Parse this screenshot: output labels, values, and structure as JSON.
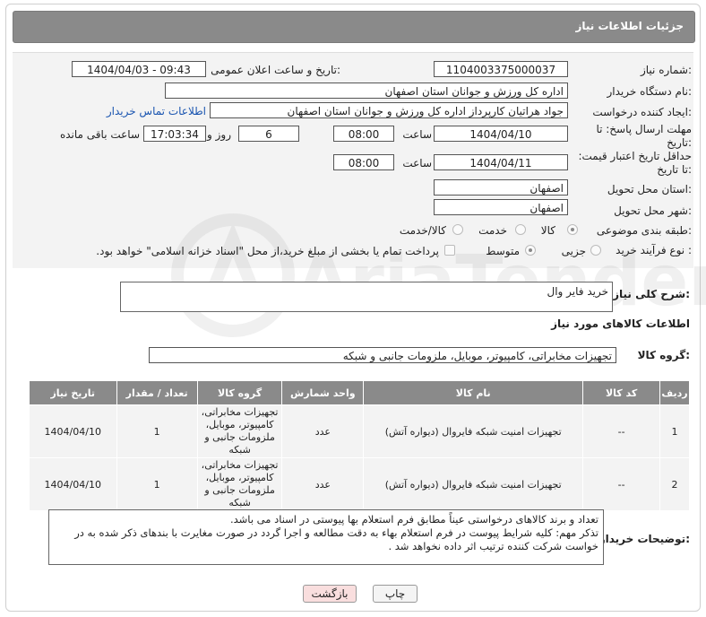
{
  "header": {
    "title": "جزئیات اطلاعات نیاز"
  },
  "form": {
    "need_number_label": "شماره نیاز:",
    "need_number": "1104003375000037",
    "announce_label": "تاریخ و ساعت اعلان عمومی:",
    "announce_value": "1404/04/03 - 09:43",
    "buyer_org_label": "نام دستگاه خریدار:",
    "buyer_org": "اداره کل ورزش و جوانان استان اصفهان",
    "creator_label": "ایجاد کننده درخواست:",
    "creator": "جواد هراتیان کارپرداز اداره کل ورزش و جوانان استان اصفهان",
    "contact_link": "اطلاعات تماس خریدار",
    "deadline_label": "مهلت ارسال پاسخ: تا تاریخ:",
    "deadline_date": "1404/04/10",
    "time_label": "ساعت",
    "deadline_time": "08:00",
    "days_value": "6",
    "days_label": "روز و",
    "remaining_time": "17:03:34",
    "remaining_label": "ساعت باقی مانده",
    "validity_label": "حداقل تاریخ اعتبار قیمت: تا تاریخ:",
    "validity_date": "1404/04/11",
    "validity_time": "08:00",
    "province_label": "استان محل تحویل:",
    "province": "اصفهان",
    "city_label": "شهر محل تحویل:",
    "city": "اصفهان",
    "category_label": "طبقه بندی موضوعی:",
    "category_options": [
      "کالا",
      "خدمت",
      "کالا/خدمت"
    ],
    "category_selected": "کالا",
    "process_label": "نوع فرآیند خرید :",
    "process_options": [
      "جزیی",
      "متوسط"
    ],
    "process_selected": "متوسط",
    "payment_note": "پرداخت تمام یا بخشی از مبلغ خرید،از محل \"اسناد خزانه اسلامی\" خواهد بود."
  },
  "summary": {
    "label": "شرح کلی نیاز:",
    "value": "خرید فایر وال"
  },
  "goods_section": {
    "title": "اطلاعات کالاهای مورد نیاز",
    "group_label": "گروه کالا:",
    "group_value": "تجهیزات مخابراتی، کامپیوتر، موبایل، ملزومات جانبی و شبکه"
  },
  "table": {
    "columns": [
      "ردیف",
      "کد کالا",
      "نام کالا",
      "واحد شمارش",
      "گروه کالا",
      "تعداد / مقدار",
      "تاریخ نیاز"
    ],
    "rows": [
      [
        "1",
        "--",
        "تجهیزات امنیت شبکه فایروال (دیواره آتش)",
        "عدد",
        "تجهیزات مخابراتی، کامپیوتر، موبایل، ملزومات جانبی و شبکه",
        "1",
        "1404/04/10"
      ],
      [
        "2",
        "--",
        "تجهیزات امنیت شبکه فایروال (دیواره آتش)",
        "عدد",
        "تجهیزات مخابراتی، کامپیوتر، موبایل، ملزومات جانبی و شبکه",
        "1",
        "1404/04/10"
      ]
    ]
  },
  "notes": {
    "label": "توضیحات خریدار:",
    "line1": "تعداد و برند کالاهای درخواستی عیناً مطابق فرم استعلام بها پیوستی در اسناد می باشد.",
    "line2": "تذکر مهم: کلیه شرایط پیوست در فرم استعلام بهاء به دقت مطالعه و اجرا گردد در صورت مغایرت با بندهای ذکر شده به در خواست شرکت کننده ترتیب اثر داده نخواهد شد ."
  },
  "buttons": {
    "print": "چاپ",
    "back": "بازگشت"
  },
  "watermark": {
    "text": "AriaTender.net"
  }
}
